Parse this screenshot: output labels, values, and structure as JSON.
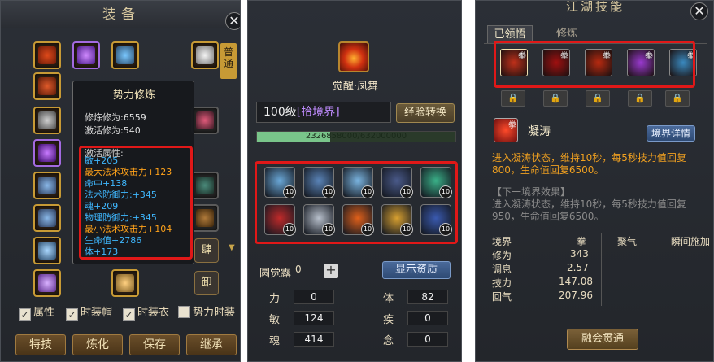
{
  "equipment_panel": {
    "title": "装备",
    "close_label": "✕",
    "side_tab_label": "普通",
    "mini_buttons": [
      "肆",
      "卸"
    ],
    "tooltip": {
      "title": "势力修炼",
      "cultivation": "修炼修为:6559",
      "activation": "激活修为:540",
      "attributes_header": "激活属性:",
      "attributes": [
        {
          "text": "敏+205",
          "color": "#3fb8ff"
        },
        {
          "text": "最大法术攻击力+123",
          "color": "#ffa21a"
        },
        {
          "text": "命中+138",
          "color": "#3fb8ff"
        },
        {
          "text": "法术防御力:+345",
          "color": "#3fb8ff"
        },
        {
          "text": "魂+209",
          "color": "#3fb8ff"
        },
        {
          "text": "物理防御力:+345",
          "color": "#3fb8ff"
        },
        {
          "text": "最小法术攻击力+104",
          "color": "#ffa21a"
        },
        {
          "text": "生命值+2786",
          "color": "#3fb8ff"
        },
        {
          "text": "体+173",
          "color": "#3fb8ff"
        }
      ]
    },
    "checkboxes": [
      {
        "label": "属性",
        "checked": true
      },
      {
        "label": "时装帽",
        "checked": true
      },
      {
        "label": "时装衣",
        "checked": true
      },
      {
        "label": "势力时装",
        "checked": false
      }
    ],
    "actions": [
      "特技",
      "炼化",
      "保存",
      "继承"
    ]
  },
  "awaken_panel": {
    "skill_name": "觉醒·凤舞",
    "level_text": "100级",
    "realm_text": "[拾境界]",
    "exp_button": "经验转换",
    "exp_current": 2326858000,
    "exp_max": 6320000000,
    "exp_text": "2326858000/632000000",
    "skill_level_label": "10",
    "skill_icons": [
      {
        "name": "ice-spear",
        "tag": "斗",
        "color": "#6aa8d8"
      },
      {
        "name": "blue-mask",
        "tag": "火",
        "color": "#5a84b8"
      },
      {
        "name": "ice-blade",
        "tag": "斩",
        "color": "#7ab4e0"
      },
      {
        "name": "constellation",
        "tag": "",
        "color": "#4a5a8a"
      },
      {
        "name": "green-ghost",
        "tag": "",
        "color": "#3ab088"
      },
      {
        "name": "red-demon",
        "tag": "",
        "color": "#c02a2a"
      },
      {
        "name": "silver-shield",
        "tag": "防",
        "color": "#b8c0cc"
      },
      {
        "name": "fire-orb",
        "tag": "",
        "color": "#e0601a"
      },
      {
        "name": "golden-lion",
        "tag": "",
        "color": "#d8a030"
      },
      {
        "name": "blue-sage",
        "tag": "",
        "color": "#3a5ab0"
      }
    ],
    "awaken_dew_label": "圆觉露",
    "awaken_dew_value": "0",
    "aptitude_button": "显示资质",
    "stats": [
      {
        "label": "力",
        "value": "0"
      },
      {
        "label": "体",
        "value": "82"
      },
      {
        "label": "敏",
        "value": "124"
      },
      {
        "label": "疾",
        "value": "0"
      },
      {
        "label": "魂",
        "value": "414"
      },
      {
        "label": "念",
        "value": "0"
      }
    ]
  },
  "jianghu_panel": {
    "title": "江湖技能",
    "close_label": "✕",
    "tabs": [
      "已领悟",
      "修炼"
    ],
    "techniques": [
      {
        "name": "fire-fist",
        "tag": "拳",
        "color": "#c0301a"
      },
      {
        "name": "red-rage",
        "tag": "拳",
        "color": "#a01010"
      },
      {
        "name": "blood-flame",
        "tag": "拳",
        "color": "#b82a10"
      },
      {
        "name": "purple-blade",
        "tag": "拳",
        "color": "#9a3ad0"
      },
      {
        "name": "ice-storm",
        "tag": "拳",
        "color": "#3a8ac0"
      }
    ],
    "lock_icon": "lock-icon",
    "selected_skill": {
      "name": "凝涛",
      "tag": "拳"
    },
    "realm_button": "境界详情",
    "description": "进入凝涛状态，维持10秒，每5秒技力值回复800，生命值回复6500。",
    "next_header": "【下一境界效果】",
    "next_description": "进入凝涛状态，维持10秒，每5秒技力值回复950，生命值回复6500。",
    "table_headers": [
      "境界",
      "拳",
      "聚气",
      "瞬间施加"
    ],
    "table_rows": [
      {
        "label": "修为",
        "value": "343"
      },
      {
        "label": "调息",
        "value": "2.57"
      },
      {
        "label": "技力",
        "value": "147.08"
      },
      {
        "label": "回气",
        "value": "207.96"
      }
    ],
    "merge_button": "融会贯通"
  }
}
